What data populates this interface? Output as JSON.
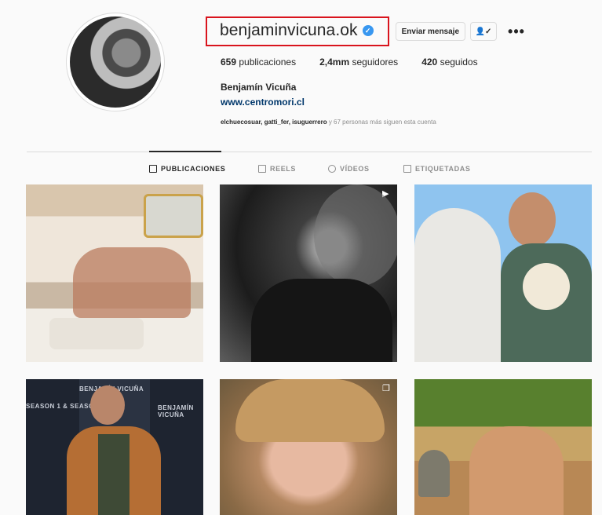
{
  "profile": {
    "handle": "benjaminvicuna.ok",
    "verified_mark": "✓",
    "message_button": "Enviar mensaje",
    "following_icon": "person-check-icon",
    "following_glyph": "👤✓",
    "more_glyph": "•••",
    "posts_count": "659",
    "posts_label": "publicaciones",
    "followers_count": "2,4mm",
    "followers_label": "seguidores",
    "following_count": "420",
    "following_label": "seguidos",
    "full_name": "Benjamín Vicuña",
    "website": "www.centromori.cl",
    "followed_by_names": "elchuecosuar, gatti_fer, isuguerrero",
    "followed_by_rest": " y 67 personas más siguen esta cuenta"
  },
  "tabs": [
    {
      "label": "PUBLICACIONES",
      "icon": "grid-icon",
      "active": true
    },
    {
      "label": "REELS",
      "icon": "reels-icon",
      "active": false
    },
    {
      "label": "VÍDEOS",
      "icon": "video-icon",
      "active": false
    },
    {
      "label": "ETIQUETADAS",
      "icon": "tag-icon",
      "active": false
    }
  ],
  "grid": {
    "watermark_line1": "BENJAMÍN VICUÑA",
    "watermark_line2": "SEASON 1 & SEASON 2",
    "reel_badge_glyph": "▶",
    "carousel_badge_glyph": "❐"
  },
  "colors": {
    "highlight_border": "#d9141d",
    "verified": "#3897f0",
    "link": "#00376b"
  }
}
